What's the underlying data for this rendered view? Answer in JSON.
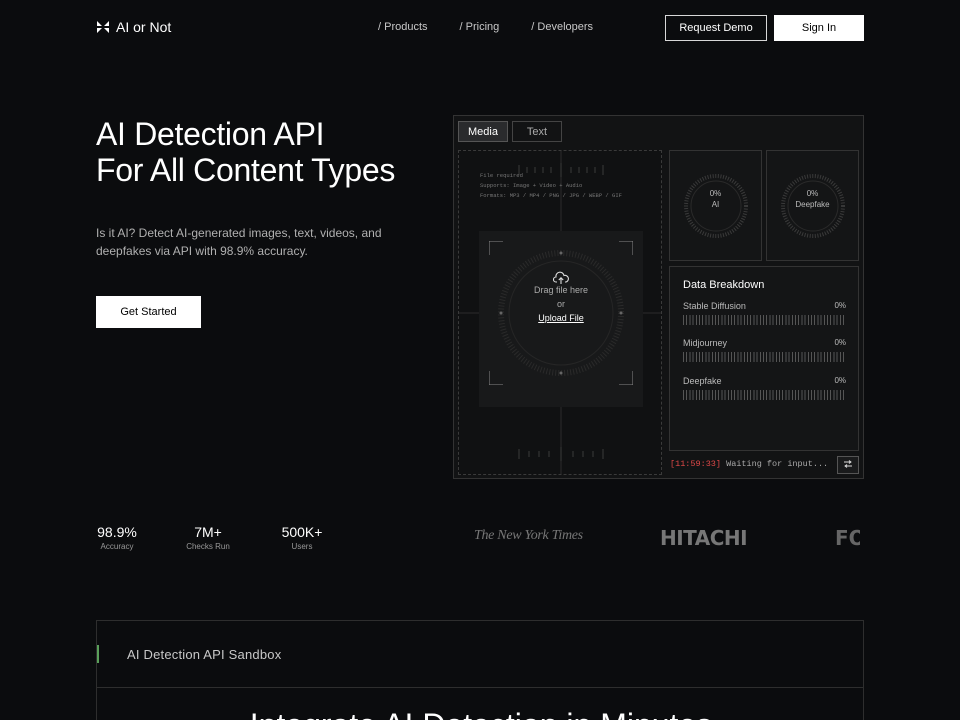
{
  "header": {
    "logo_text": "AI or Not",
    "nav": [
      "/ Products",
      "/ Pricing",
      "/ Developers"
    ],
    "request_demo": "Request Demo",
    "sign_in": "Sign In"
  },
  "hero": {
    "title_line1": "AI Detection API",
    "title_line2": "For All Content Types",
    "subtitle": "Is it AI? Detect AI-generated images, text, videos, and deepfakes via API with 98.9% accuracy.",
    "cta": "Get Started"
  },
  "widget": {
    "tabs": [
      "Media",
      "Text"
    ],
    "active_tab": "Media",
    "meta_lines": [
      "File required",
      "Supports: Image + Video + Audio",
      "Formats: MP3 / MP4 / PNG / JPG / WEBP / GIF"
    ],
    "drag_text": "Drag file here",
    "or_text": "or",
    "upload_link": "Upload File",
    "gauges": [
      {
        "value": "0%",
        "label": "AI"
      },
      {
        "value": "0%",
        "label": "Deepfake"
      }
    ],
    "breakdown": {
      "title": "Data Breakdown",
      "rows": [
        {
          "label": "Stable Diffusion",
          "value": "0%"
        },
        {
          "label": "Midjourney",
          "value": "0%"
        },
        {
          "label": "Deepfake",
          "value": "0%"
        }
      ]
    },
    "status_time": "[11:59:33]",
    "status_text": "Waiting for input..."
  },
  "stats": [
    {
      "value": "98.9%",
      "label": "Accuracy"
    },
    {
      "value": "7M+",
      "label": "Checks Run"
    },
    {
      "value": "500K+",
      "label": "Users"
    }
  ],
  "press_logos": [
    "The New York Times",
    "HITACHI",
    "FOX"
  ],
  "sandbox": {
    "title": "AI Detection API Sandbox",
    "heading": "Integrate AI Detection in Minutes"
  },
  "colors": {
    "background": "#0b0c0e",
    "accent_green": "#5aa05a",
    "status_red": "#e04848"
  }
}
